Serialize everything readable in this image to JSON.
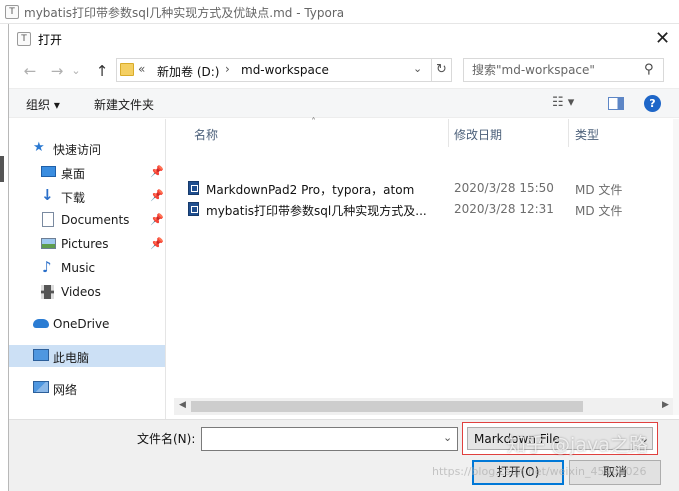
{
  "app": {
    "title": "mybatis打印带参数sql几种实现方式及优缺点.md - Typora",
    "icon": "typora-icon"
  },
  "dialog": {
    "title": "打开",
    "close_glyph": "✕"
  },
  "nav": {
    "back_glyph": "←",
    "forward_glyph": "→",
    "history_glyph": "⌄",
    "up_glyph": "↑",
    "breadcrumb": [
      "新加卷 (D:)",
      "md-workspace"
    ],
    "overflow_glyph": "«",
    "separator_glyph": "›",
    "dropdown_glyph": "⌄",
    "refresh_glyph": "↻",
    "search_placeholder": "搜索\"md-workspace\"",
    "search_glyph": "⚲"
  },
  "toolbar": {
    "organize": "组织 ▾",
    "new_folder": "新建文件夹",
    "view_glyph": "☷ ▾",
    "help": "?"
  },
  "sidebar": {
    "items": [
      {
        "label": "快速访问",
        "icon": "star-icon",
        "pinned": false
      },
      {
        "label": "桌面",
        "icon": "desktop-icon",
        "pinned": true
      },
      {
        "label": "下载",
        "icon": "download-icon",
        "pinned": true
      },
      {
        "label": "Documents",
        "icon": "documents-icon",
        "pinned": true
      },
      {
        "label": "Pictures",
        "icon": "pictures-icon",
        "pinned": true
      },
      {
        "label": "Music",
        "icon": "music-icon",
        "pinned": false
      },
      {
        "label": "Videos",
        "icon": "videos-icon",
        "pinned": false
      },
      {
        "label": "OneDrive",
        "icon": "cloud-icon",
        "pinned": false
      },
      {
        "label": "此电脑",
        "icon": "computer-icon",
        "pinned": false,
        "selected": true
      },
      {
        "label": "网络",
        "icon": "network-icon",
        "pinned": false
      }
    ],
    "pin_glyph": "📌"
  },
  "filelist": {
    "columns": {
      "name": "名称",
      "date": "修改日期",
      "type": "类型"
    },
    "sort_glyph": "˄",
    "rows": [
      {
        "name": "MarkdownPad2 Pro，typora，atom",
        "date": "2020/3/28 15:50",
        "type": "MD 文件"
      },
      {
        "name": "mybatis打印带参数sql几种实现方式及...",
        "date": "2020/3/28 12:31",
        "type": "MD 文件"
      }
    ]
  },
  "bottom": {
    "filename_label": "文件名(N):",
    "filename_value": "",
    "filetype_value": "Markdown File",
    "open_label": "打开(O)",
    "cancel_label": "取消"
  },
  "watermark": {
    "brand": "知乎 @java之路",
    "url": "https://blog.csdn.net/weixin_45900026"
  },
  "colors": {
    "accent": "#0078d7",
    "selection": "#cce0f5",
    "highlight_border": "#e0403e",
    "help_blue": "#1e66c8"
  }
}
